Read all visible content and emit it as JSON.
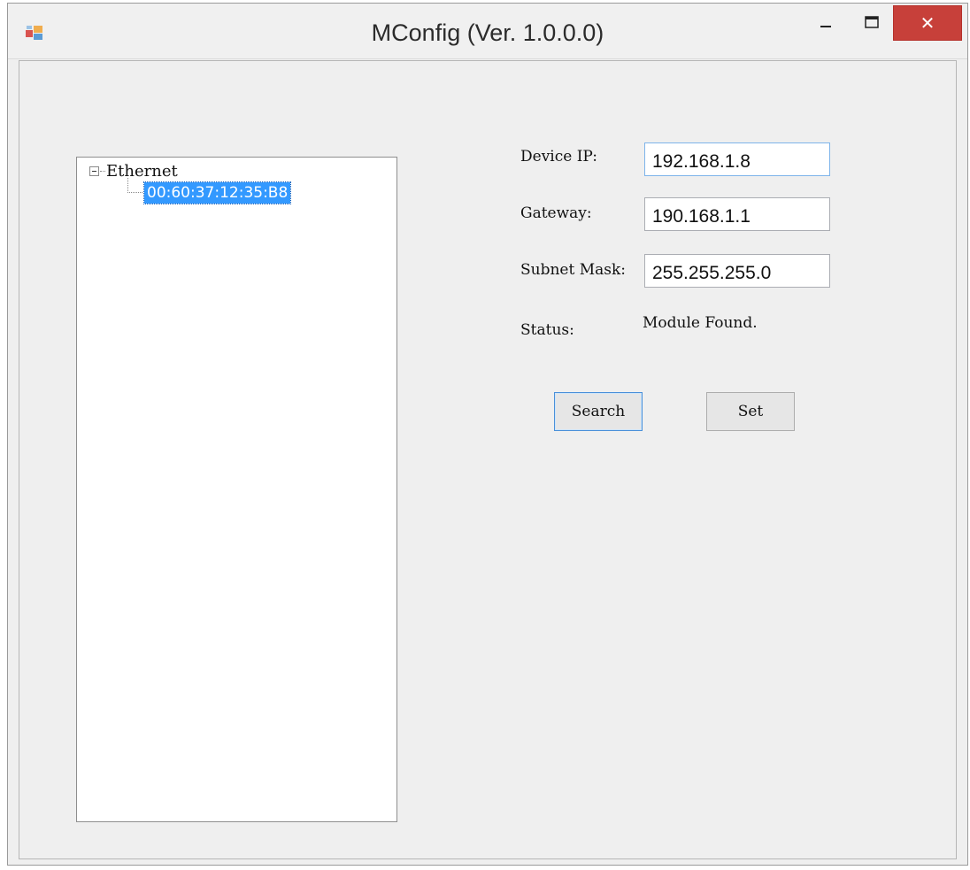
{
  "window": {
    "title": "MConfig (Ver. 1.0.0.0)",
    "close_label": "✕",
    "accent": "#c7403a"
  },
  "tree": {
    "root_label": "Ethernet",
    "children": [
      {
        "label": "00:60:37:12:35:B8",
        "selected": true
      }
    ]
  },
  "form": {
    "device_ip_label": "Device IP:",
    "device_ip_value": "192.168.1.8",
    "gateway_label": "Gateway:",
    "gateway_value": "190.168.1.1",
    "subnet_label": "Subnet Mask:",
    "subnet_value": "255.255.255.0",
    "status_label": "Status:",
    "status_value": "Module Found."
  },
  "buttons": {
    "search_label": "Search",
    "set_label": "Set"
  },
  "colors": {
    "selection": "#3399ff",
    "focus_border": "#7eb4ea"
  }
}
